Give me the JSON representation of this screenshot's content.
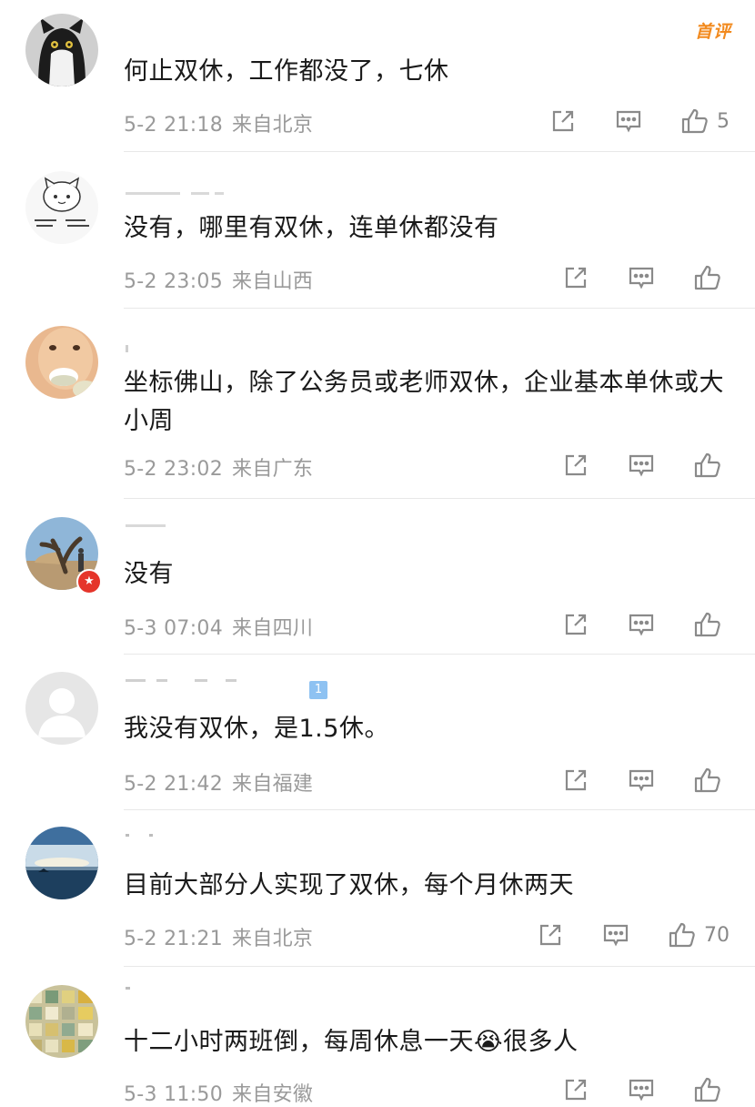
{
  "first_comment_badge": "首评",
  "comments": [
    {
      "text": "何止双休，工作都没了，七休",
      "date": "5-2 21:18",
      "location": "来自北京",
      "likes": "5"
    },
    {
      "text": "没有，哪里有双休，连单休都没有",
      "date": "5-2 23:05",
      "location": "来自山西",
      "likes": ""
    },
    {
      "text": "坐标佛山，除了公务员或老师双休，企业基本单休或大小周",
      "date": "5-2 23:02",
      "location": "来自广东",
      "likes": ""
    },
    {
      "text": "没有",
      "date": "5-3 07:04",
      "location": "来自四川",
      "likes": ""
    },
    {
      "text": "我没有双休，是1.5休。",
      "date": "5-2 21:42",
      "location": "来自福建",
      "likes": "",
      "level_badge": "1"
    },
    {
      "text": "目前大部分人实现了双休，每个月休两天",
      "date": "5-2 21:21",
      "location": "来自北京",
      "likes": "70"
    },
    {
      "text": "十二小时两班倒，每周休息一天😭很多人",
      "date": "5-3 11:50",
      "location": "来自安徽",
      "likes": ""
    }
  ],
  "icons": {
    "share": "share-icon",
    "reply": "comment-icon",
    "like": "thumbs-up-icon",
    "vip": "star-badge-icon"
  },
  "colors": {
    "text": "#1a1a1a",
    "meta": "#9a9a9a",
    "accent_first": "#f28a1e",
    "vip_red": "#e5352b",
    "divider": "#e8e8e8"
  }
}
